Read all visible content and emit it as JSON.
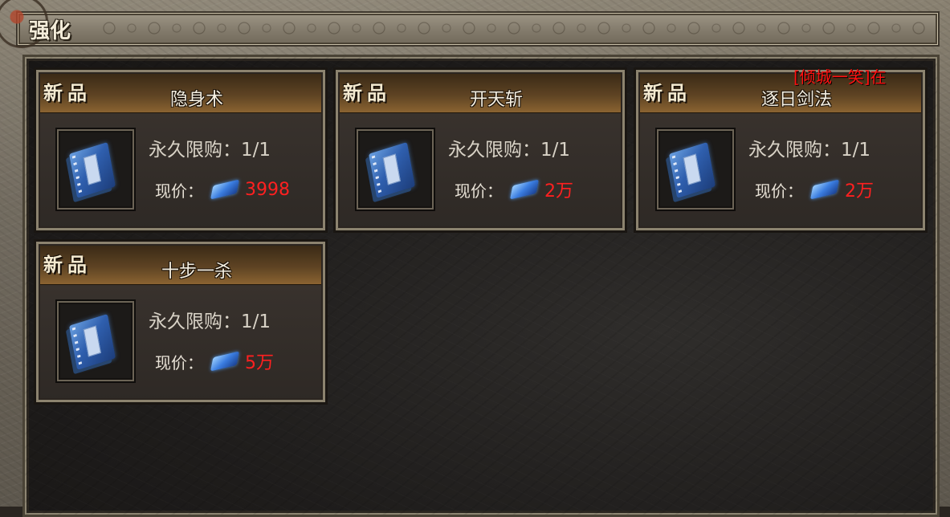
{
  "window": {
    "title": "强化"
  },
  "chat": {
    "message": "[倾城一笑]在"
  },
  "currency_icon": "diamond-gem-icon",
  "colors": {
    "price": "#ff2020",
    "chat": "#ff1010",
    "text": "#f6f0e2"
  },
  "items": [
    {
      "tag": "新品",
      "name": "隐身术",
      "limit": "永久限购：1/1",
      "price_label": "现价：",
      "price": "3998",
      "icon": "skill-book-icon"
    },
    {
      "tag": "新品",
      "name": "开天斩",
      "limit": "永久限购：1/1",
      "price_label": "现价：",
      "price": "2万",
      "icon": "skill-book-icon"
    },
    {
      "tag": "新品",
      "name": "逐日剑法",
      "limit": "永久限购：1/1",
      "price_label": "现价：",
      "price": "2万",
      "icon": "skill-book-icon"
    },
    {
      "tag": "新品",
      "name": "十步一杀",
      "limit": "永久限购：1/1",
      "price_label": "现价：",
      "price": "5万",
      "icon": "skill-book-icon"
    }
  ]
}
